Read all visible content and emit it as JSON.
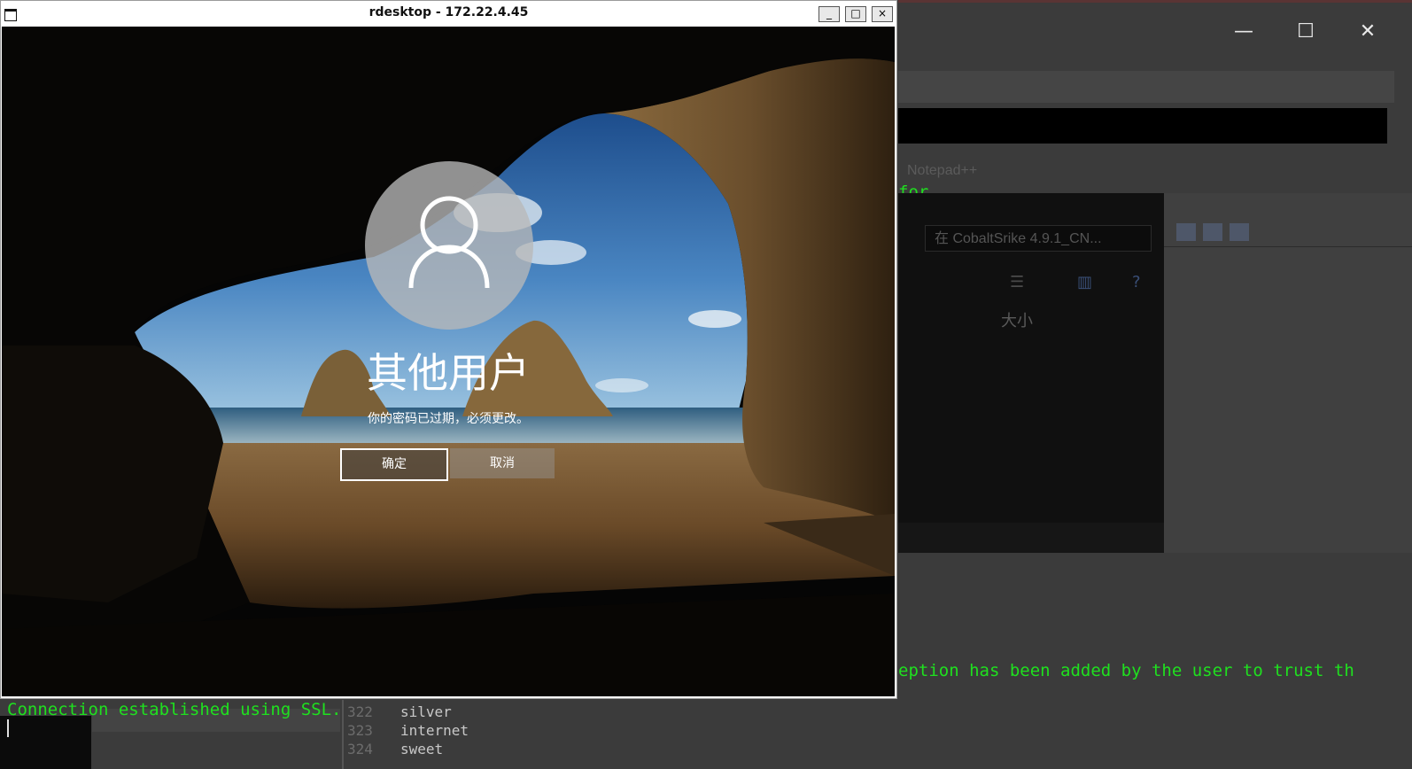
{
  "rdesktop": {
    "title": "rdesktop - 172.22.4.45",
    "controls": {
      "minimize": "_",
      "maximize": "□",
      "close": "×"
    }
  },
  "login": {
    "user_name": "其他用户",
    "message": "你的密码已过期，必须更改。",
    "ok_label": "确定",
    "cancel_label": "取消"
  },
  "background": {
    "window_controls": {
      "minimize": "—",
      "maximize": "☐",
      "close": "✕"
    },
    "notepad_title": "Notepad++",
    "terminal_fragment_1": "for",
    "terminal_fragment_2": ".",
    "terminal_exception_line": "eption has been added by the user to trust th",
    "terminal_connection_line": "Connection established using SSL.",
    "explorer_search_placeholder": "在 CobaltSrike 4.9.1_CN...",
    "explorer_column_header": "大小",
    "editor_lines": [
      {
        "num": "322",
        "text": "silver"
      },
      {
        "num": "323",
        "text": "internet"
      },
      {
        "num": "324",
        "text": "sweet"
      }
    ]
  },
  "colors": {
    "terminal_green": "#1fe01f",
    "desktop_bg": "#3b3b3b",
    "titlebar_bg": "#ffffff"
  },
  "icons": [
    "window-menu-icon",
    "minimize-icon",
    "maximize-icon",
    "close-icon",
    "user-avatar-icon",
    "search-icon",
    "help-icon"
  ]
}
